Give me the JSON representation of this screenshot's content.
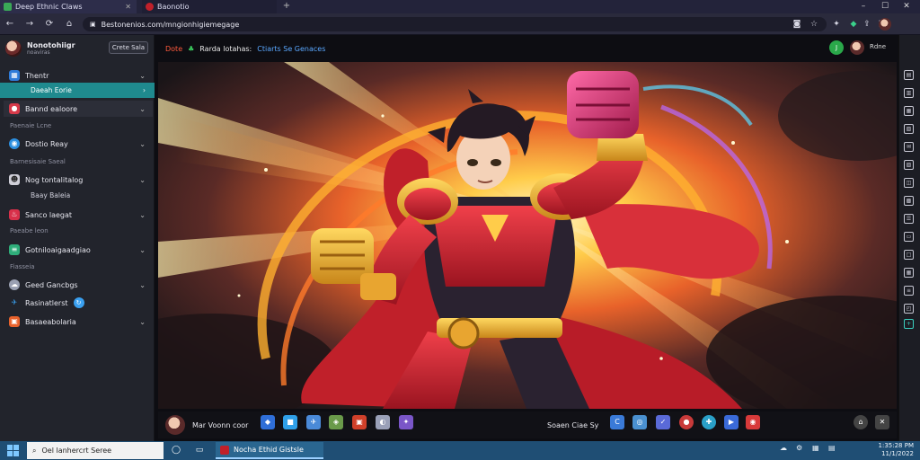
{
  "browser": {
    "tabs": [
      {
        "label": "Deep Ethnic Claws",
        "color": "#3aa857"
      },
      {
        "label": "Baonotio",
        "color": "#c0202a"
      }
    ],
    "new_tab": "+",
    "window_controls": [
      "–",
      "☐",
      "✕"
    ],
    "nav_buttons": [
      "arrow-left",
      "arrow-right",
      "reload",
      "home"
    ],
    "url": "Bestonenios.com/mngionhigiemegage",
    "toolbar_icons": [
      "camera-icon",
      "star-icon",
      "extension-icon",
      "gem-icon",
      "share-icon",
      "menu-icon",
      "profile-icon"
    ]
  },
  "sidebar": {
    "profile_name": "Nonotohiigr",
    "profile_sub": "noaviras",
    "create_button": "Crete Sala",
    "items": [
      {
        "label": "Thentr",
        "type": "nav",
        "icon": "grid-icon",
        "color": "#2f7bd8"
      },
      {
        "label": "Daeah Eorie",
        "type": "sub-active"
      },
      {
        "label": "Bannd ealoore",
        "type": "nav",
        "icon": "flame-icon",
        "color": "#d63a4a"
      },
      {
        "label": "Paenaie Lcne",
        "type": "section"
      },
      {
        "label": "Dostio Reay",
        "type": "nav",
        "icon": "globe-icon",
        "color": "#2c8fe0"
      },
      {
        "label": "Barnesisaie Saeal",
        "type": "section"
      },
      {
        "label": "Nog tontalitalog",
        "type": "nav",
        "icon": "mask-icon",
        "color": "#cfcfd8"
      },
      {
        "label": "Baay Baleia",
        "type": "sub"
      },
      {
        "label": "Sanco laegat",
        "type": "nav",
        "icon": "fire-icon",
        "color": "#d8304a"
      },
      {
        "label": "Paeabe leon",
        "type": "section"
      },
      {
        "label": "Gotniloaigaadgiao",
        "type": "nav",
        "icon": "stack-icon",
        "color": "#2fae7a"
      },
      {
        "label": "Fiasseia",
        "type": "section"
      },
      {
        "label": "Geed Gancbgs",
        "type": "nav",
        "icon": "cloud-icon",
        "color": "#9aa0b2"
      },
      {
        "label": "Rasinatlerst",
        "type": "nav-badge",
        "icon": "twitter-icon",
        "color": "#3aa0f0"
      },
      {
        "label": "Basaeabolaria",
        "type": "nav",
        "icon": "apps-icon",
        "color": "#e8622c"
      }
    ]
  },
  "header": {
    "part_red": "Dote",
    "part_green": "Rarda lotahas:",
    "part_blue": "Ctiarts Se Genaces",
    "badge_letter": "J",
    "user_label": "Rdne"
  },
  "hero": {
    "subject": "anime-hero-red-armor-fist-raised",
    "colors": {
      "armor": "#d4232e",
      "gold": "#e8a530",
      "glow": "#ffd24a",
      "hair": "#241a24",
      "bg_dark": "#1a1518"
    }
  },
  "bottom_bar": {
    "user_name": "Mar Voonn coor",
    "center_label": "Soaen Ciae Sy",
    "app_icons_left": [
      "#2f6fd8",
      "#2fa0e8",
      "#4a8ad8",
      "#6a9a4a",
      "#d0402a",
      "#9aa0b8",
      "#7a56c8"
    ],
    "app_icons_right": [
      "#3a7ad8",
      "#4a90d0",
      "#5a6ad8",
      "#c83a3a",
      "#2aa0c8",
      "#3a6ad8",
      "#d83a3a"
    ]
  },
  "right_rail_icon_count": 16,
  "taskbar": {
    "search_placeholder": "Oel lanhercrt Seree",
    "active_window": "Nocha Ethid Gistsle",
    "tray_items": [
      "☁",
      "⚙",
      "▦",
      "▤"
    ],
    "clock_time": "1:35:28 PM",
    "clock_date": "11/1/2022"
  }
}
